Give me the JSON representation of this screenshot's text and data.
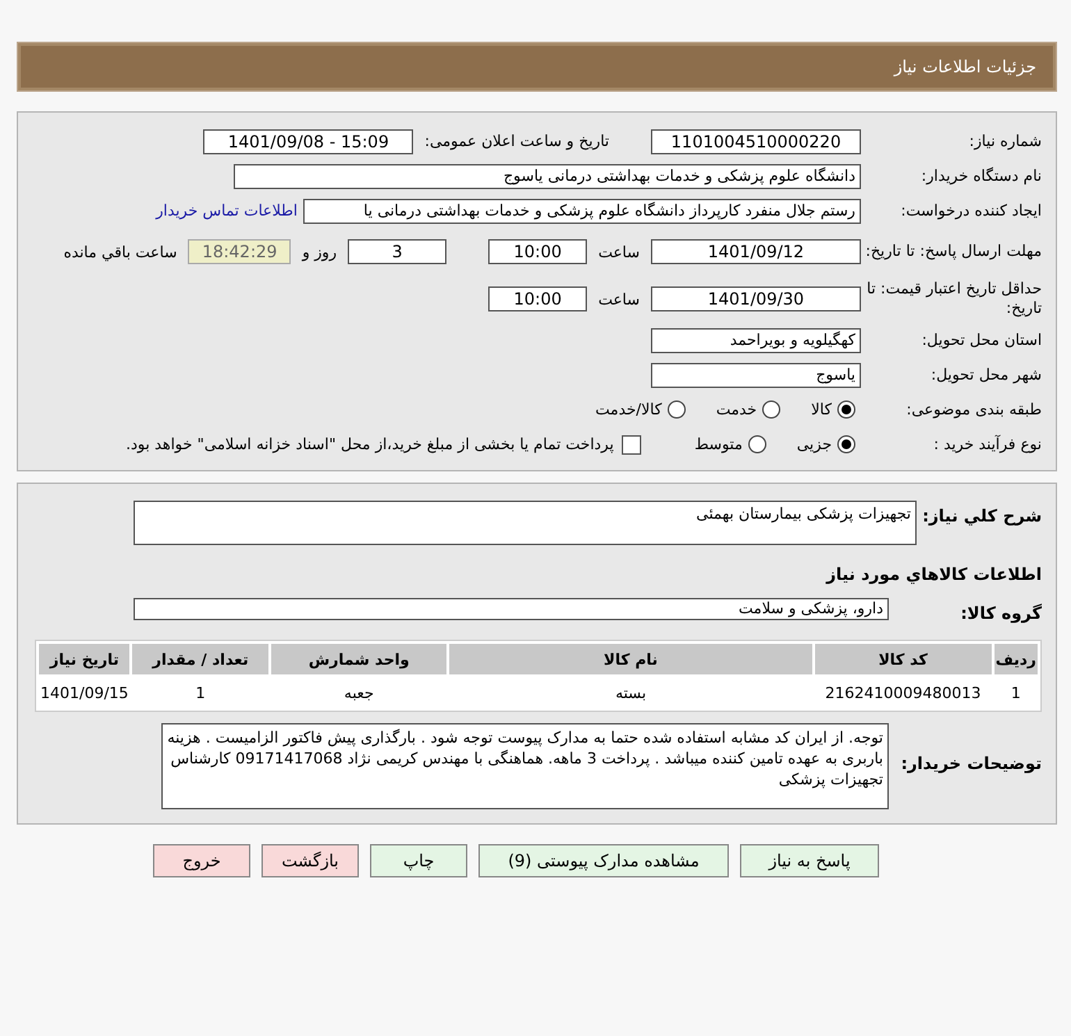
{
  "header": {
    "title": "جزئیات اطلاعات نیاز"
  },
  "details": {
    "need_number": {
      "label": "شماره نیاز:",
      "value": "1101004510000220"
    },
    "announce": {
      "label": "تاریخ و ساعت اعلان عمومی:",
      "value": "1401/09/08 - 15:09"
    },
    "buyer": {
      "label": "نام دستگاه خریدار:",
      "value": "دانشگاه علوم پزشکی و خدمات بهداشتی  درمانی یاسوج"
    },
    "creator": {
      "label": "ایجاد کننده درخواست:",
      "value": "رستم جلال منفرد کارپرداز دانشگاه علوم پزشکی و خدمات بهداشتی  درمانی یا",
      "link": "اطلاعات تماس خریدار"
    },
    "deadline": {
      "label": "مهلت ارسال پاسخ: تا تاریخ:",
      "date": "1401/09/12",
      "time_label": "ساعت",
      "time": "10:00",
      "days": "3",
      "days_label": "روز و",
      "remaining": "18:42:29",
      "remaining_label": "ساعت باقي مانده"
    },
    "validity": {
      "label": "حداقل تاریخ اعتبار قیمت: تا تاریخ:",
      "date": "1401/09/30",
      "time_label": "ساعت",
      "time": "10:00"
    },
    "province": {
      "label": "استان محل تحویل:",
      "value": "کهگیلویه و بویراحمد"
    },
    "city": {
      "label": "شهر محل تحویل:",
      "value": "یاسوج"
    },
    "category": {
      "label": "طبقه بندی موضوعی:",
      "options": [
        {
          "label": "کالا",
          "selected": true
        },
        {
          "label": "خدمت",
          "selected": false
        },
        {
          "label": "کالا/خدمت",
          "selected": false
        }
      ]
    },
    "purchase_type": {
      "label": "نوع فرآیند خرید :",
      "options": [
        {
          "label": "جزیی",
          "selected": true
        },
        {
          "label": "متوسط",
          "selected": false
        }
      ],
      "payment": {
        "checked": false,
        "text": "پرداخت تمام یا بخشی از مبلغ خرید،از محل \"اسناد خزانه اسلامی\" خواهد بود."
      }
    }
  },
  "description": {
    "label": "شرح کلي نياز:",
    "value": "تجهیزات پزشکی بیمارستان بهمئی"
  },
  "goods_heading": "اطلاعات کالاهاي مورد نياز",
  "goods_group": {
    "label": "گروه کالا:",
    "value": "دارو، پزشکی و سلامت"
  },
  "table": {
    "columns": [
      "ردیف",
      "کد کالا",
      "نام کالا",
      "واحد شمارش",
      "تعداد / مقدار",
      "تاریخ نیاز"
    ],
    "rows": [
      [
        "1",
        "2162410009480013",
        "بسته",
        "جعبه",
        "1",
        "1401/09/15"
      ]
    ]
  },
  "buyer_notes": {
    "label": "توضیحات خریدار:",
    "value": "توجه. از ایران کد مشابه استفاده شده حتما به مدارک پیوست توجه شود . بارگذاری پیش فاکتور الزامیست . هزینه باربری به عهده تامین کننده میباشد . پرداخت 3 ماهه. هماهنگی با مهندس کریمی نژاد 09171417068 کارشناس تجهیزات پزشکی"
  },
  "buttons": [
    {
      "label": "پاسخ به نیاز",
      "kind": "normal"
    },
    {
      "label": "مشاهده مدارک پیوستی (9)",
      "kind": "normal"
    },
    {
      "label": "چاپ",
      "kind": "normal"
    },
    {
      "label": "بازگشت",
      "kind": "warning"
    },
    {
      "label": "خروج",
      "kind": "warning"
    }
  ]
}
